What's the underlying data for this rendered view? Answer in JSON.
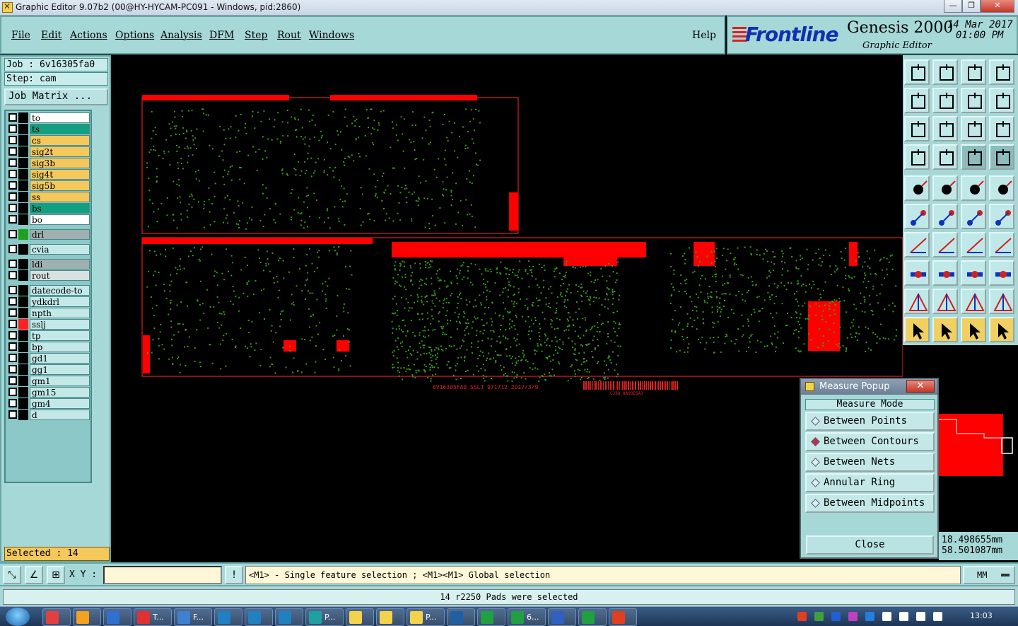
{
  "window": {
    "title": "Graphic Editor 9.07b2 (00@HY-HYCAM-PC091 - Windows, pid:2860)",
    "minimize": "—",
    "restore": "❐",
    "close": "✕"
  },
  "menu": [
    "File",
    "Edit",
    "Actions",
    "Options",
    "Analysis",
    "DFM",
    "Step",
    "Rout",
    "Windows"
  ],
  "help": "Help",
  "brand": {
    "logo": "Frontline",
    "product": "Genesis 2000",
    "subtitle": "Graphic Editor",
    "date": "14 Mar 2017",
    "time": "01:00 PM"
  },
  "job": {
    "job_label": "Job : 6v16305fa0",
    "step_label": "Step: cam",
    "matrix_button": "Job Matrix ..."
  },
  "layers": [
    {
      "name": "to",
      "color": "#ffffff",
      "mark": "#000000"
    },
    {
      "name": "ts",
      "color": "#10a080",
      "mark": "#000000"
    },
    {
      "name": "cs",
      "color": "#f4c85a",
      "mark": "#000000"
    },
    {
      "name": "sig2t",
      "color": "#f4c85a",
      "mark": "#000000"
    },
    {
      "name": "sig3b",
      "color": "#f4c85a",
      "mark": "#000000"
    },
    {
      "name": "sig4t",
      "color": "#f4c85a",
      "mark": "#000000"
    },
    {
      "name": "sig5b",
      "color": "#f4c85a",
      "mark": "#000000"
    },
    {
      "name": "ss",
      "color": "#f4c85a",
      "mark": "#000000"
    },
    {
      "name": "bs",
      "color": "#10a080",
      "mark": "#000000"
    },
    {
      "name": "bo",
      "color": "#ffffff",
      "mark": "#000000"
    },
    {
      "name": "drl",
      "color": "#a0b0b0",
      "mark": "#20a020"
    },
    {
      "name": "cvia",
      "color": "#c4e8e8",
      "mark": "#000000"
    },
    {
      "name": "ldi",
      "color": "#a0b0b0",
      "mark": "#000000"
    },
    {
      "name": "rout",
      "color": "#d8e0e0",
      "mark": "#000000"
    },
    {
      "name": "datecode-to",
      "color": "#c4e8e8",
      "mark": "#000000"
    },
    {
      "name": "ydkdrl",
      "color": "#c4e8e8",
      "mark": "#000000"
    },
    {
      "name": "npth",
      "color": "#c4e8e8",
      "mark": "#000000"
    },
    {
      "name": "sslj",
      "color": "#c4e8e8",
      "mark": "#ff2020"
    },
    {
      "name": "tp",
      "color": "#c4e8e8",
      "mark": "#000000"
    },
    {
      "name": "bp",
      "color": "#c4e8e8",
      "mark": "#000000"
    },
    {
      "name": "gd1",
      "color": "#c4e8e8",
      "mark": "#000000"
    },
    {
      "name": "gg1",
      "color": "#c4e8e8",
      "mark": "#000000"
    },
    {
      "name": "gm1",
      "color": "#c4e8e8",
      "mark": "#000000"
    },
    {
      "name": "gm15",
      "color": "#c4e8e8",
      "mark": "#000000"
    },
    {
      "name": "gm4",
      "color": "#c4e8e8",
      "mark": "#000000"
    },
    {
      "name": "d",
      "color": "#c4e8e8",
      "mark": "#000000"
    }
  ],
  "selected_label": "Selected : 14",
  "canvas": {
    "board_text": "6V16305FA0 SSLJ 971712 2017/3/9",
    "barcode_text": "CJ88 8A80E9AЭ"
  },
  "toolbar": [
    "zoom-home-icon",
    "zoom-in-icon",
    "home-icon",
    "window-icon",
    "pan-left-icon",
    "pan-right-icon",
    "rotate-icon",
    "mirror-icon",
    "fit-icon",
    "center-icon",
    "scale-1-1-icon",
    "help-question-icon",
    "tools-icon",
    "snap-icon",
    "layers-a-icon",
    "layers-b-icon",
    "pad-select-icon",
    "edit-shape-icon",
    "ruler-icon",
    "circle-icon",
    "nodes-icon",
    "cross-icon",
    "line-pad-icon",
    "line-pad-b-icon",
    "angle-icon",
    "diagonal-icon",
    "arc-icon",
    "fh-icon",
    "move-icon",
    "split-icon",
    "measure-box-icon",
    "shapes-icon",
    "triangle-a-icon",
    "triangle-b-icon",
    "triangle-c-icon",
    "triangle-d-icon",
    "pointer-icon",
    "pointer-box-icon",
    "pointer-circle-icon",
    "pointer-link-icon"
  ],
  "measure_popup": {
    "title": "Measure Popup",
    "close_x": "✕",
    "mode_header": "Measure Mode",
    "modes": [
      "Between Points",
      "Between Contours",
      "Between Nets",
      "Annular Ring",
      "Between Midpoints"
    ],
    "active_mode": "Between Contours",
    "close_button": "Close"
  },
  "coords": {
    "x": "18.498655mm",
    "y": "58.501087mm"
  },
  "command": {
    "xy_label": "X Y :",
    "xy_value": "",
    "hint": "<M1> - Single feature selection ; <M1><M1> Global selection",
    "units": "MM"
  },
  "status_message": "14 r2250 Pads were selected",
  "taskbar": {
    "items": [
      "",
      "",
      "",
      "T...",
      "F...",
      "",
      "",
      "",
      "P...",
      "",
      "",
      "P...",
      "",
      "",
      "6...",
      "",
      "",
      ""
    ],
    "clock": "13:03"
  },
  "colors": {
    "panel": "#a6d8d8",
    "copper": "#ff0000",
    "pad": "#3a9a20",
    "outline": "#e02020"
  }
}
